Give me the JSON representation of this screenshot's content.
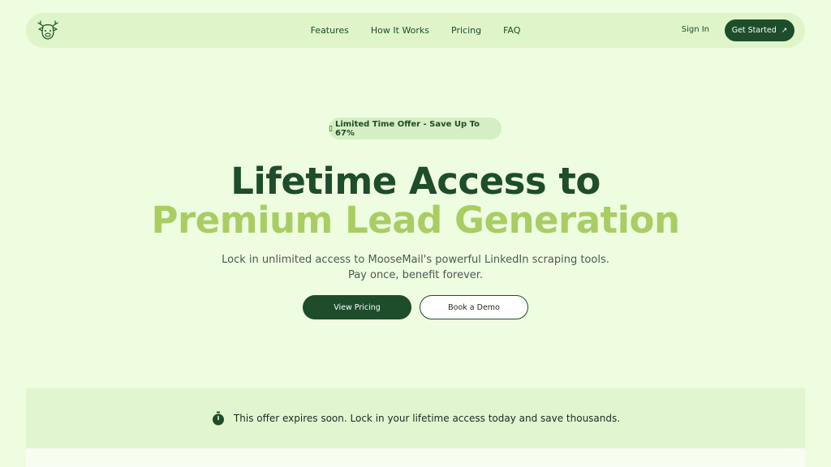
{
  "nav": {
    "logo_icon": "moose-head-icon",
    "links": [
      "Features",
      "How It Works",
      "Pricing",
      "FAQ"
    ],
    "sign_in": "Sign In",
    "get_started": "Get Started",
    "get_started_icon": "arrow-up-right-icon"
  },
  "hero": {
    "badge_icon": "▯",
    "badge_text": "Limited Time Offer - Save Up To 67%",
    "headline_line1": "Lifetime Access to",
    "headline_line2": "Premium Lead Generation",
    "subtext_line1": "Lock in unlimited access to MooseMail's powerful LinkedIn scraping tools.",
    "subtext_line2": "Pay once, benefit forever.",
    "primary_button": "View Pricing",
    "secondary_button": "Book a Demo"
  },
  "banner": {
    "icon": "stopwatch-icon",
    "text": "This offer expires soon. Lock in your lifetime access today and save thousands."
  },
  "colors": {
    "page_bg": "#eefce0",
    "nav_bg": "#dff5c9",
    "dark_green": "#1d4d2b",
    "lime_accent": "#a9cd62",
    "banner_bg": "#e2f5d1"
  }
}
